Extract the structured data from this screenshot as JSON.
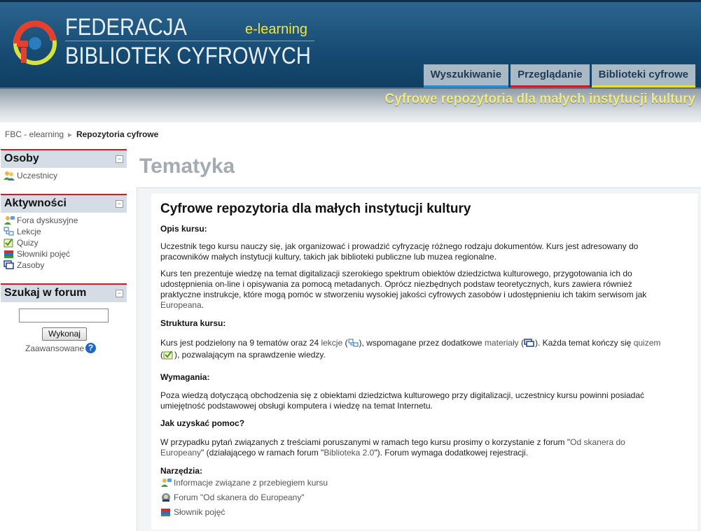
{
  "header": {
    "logo_line1": "FEDERACJA",
    "logo_line2": "BIBLIOTEK CYFROWYCH",
    "elearning": "e-learning",
    "tabs": [
      "Wyszukiwanie",
      "Przeglądanie",
      "Biblioteki cyfrowe"
    ],
    "subtitle": "Cyfrowe repozytoria dla małych instytucji kultury"
  },
  "breadcrumb": {
    "root": "FBC - elearning",
    "separator": "►",
    "current": "Repozytoria cyfrowe"
  },
  "sidebar": {
    "osoby": {
      "title": "Osoby",
      "items": [
        "Uczestnicy"
      ]
    },
    "aktywnosci": {
      "title": "Aktywności",
      "items": [
        "Fora dyskusyjne",
        "Lekcje",
        "Quizy",
        "Słowniki pojęć",
        "Zasoby"
      ]
    },
    "search": {
      "title": "Szukaj w forum",
      "button": "Wykonaj",
      "advanced": "Zaawansowane",
      "help": "?"
    }
  },
  "main": {
    "heading": "Tematyka",
    "course_title": "Cyfrowe repozytoria dla małych instytucji kultury",
    "opis_label": "Opis kursu:",
    "opis_p1": [
      "Uczestnik tego kursu nauczy się, jak organizować i prowadzić cyfryzację różnego rodzaju dokumentów. Kurs jest adresowany do",
      "pracowników małych instytucji kultury, takich jak biblioteki publiczne lub muzea regionalne."
    ],
    "opis_p2": [
      "Kurs ten prezentuje wiedzę na temat digitalizacji szerokiego spektrum obiektów dziedzictwa kulturowego, przygotowania ich do",
      "udostępnienia on-line i opisywania za pomocą metadanych. Oprócz niezbędnych podstaw teoretycznych, kurs zawiera również",
      "praktyczne instrukcje, które mogą pomóc w stworzeniu wysokiej jakości cyfrowych zasobów i udostępnieniu ich takim serwisom jak"
    ],
    "opis_p2_link": "Europeana",
    "opis_p2_end": ".",
    "struktura_label": "Struktura kursu:",
    "struktura": {
      "t1": "Kurs jest podzielony na 9 tematów oraz 24 ",
      "lekcje": "lekcje",
      "t2": " (",
      "t3": "), wspomagane przez dodatkowe ",
      "materialy": "materiały",
      "t4": " (",
      "t5": "). Każda temat kończy się ",
      "quizem": "quizem",
      "t6": "(",
      "t7": "), pozwalającym na sprawdzenie wiedzy."
    },
    "wymagania_label": "Wymagania:",
    "wymagania": [
      "Poza wiedzą dotyczącą obchodzenia się z obiektami dziedzictwa kulturowego przy digitalizacji, uczestnicy kursu powinni posiadać",
      "umiejętność podstawowej obsługi komputera i wiedzę na temat Internetu."
    ],
    "pomoc_label": "Jak uzyskać pomoc?",
    "pomoc": {
      "l1a": "W przypadku pytań związanych z treściami poruszanymi w ramach tego kursu prosimy o korzystanie z forum \"",
      "l1link": "Od skanera do",
      "l2link": "Europeany",
      "l2a": "\" (działającego w ramach forum \"",
      "l2link2": "Biblioteka 2.0",
      "l2b": "\"). Forum wymaga dodatkowej rejestracji."
    },
    "narzedzia_label": "Narzędzia:",
    "narzedzia": [
      "Informacje związane z przebiegiem kursu",
      "Forum \"Od skanera do Europeany\"",
      "Słownik pojęć"
    ]
  },
  "colors": {
    "header_blue": "#174b72",
    "accent_red": "#d11c25",
    "accent_yellow": "#f4e53d"
  }
}
